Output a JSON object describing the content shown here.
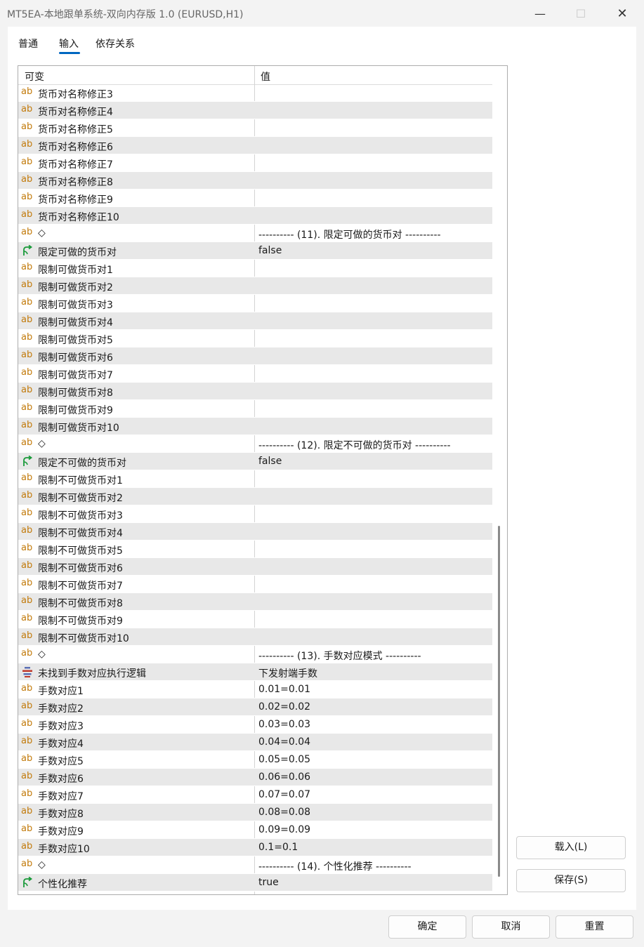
{
  "window": {
    "title": "MT5EA-本地跟单系统-双向内存版 1.0 (EURUSD,H1)"
  },
  "tabs": [
    "普通",
    "输入",
    "依存关系"
  ],
  "grid": {
    "headers": {
      "variable": "可变",
      "value": "值"
    },
    "rows": [
      {
        "icon": "ab",
        "name": "货币对名称修正3",
        "value": ""
      },
      {
        "icon": "ab",
        "name": "货币对名称修正4",
        "value": ""
      },
      {
        "icon": "ab",
        "name": "货币对名称修正5",
        "value": ""
      },
      {
        "icon": "ab",
        "name": "货币对名称修正6",
        "value": ""
      },
      {
        "icon": "ab",
        "name": "货币对名称修正7",
        "value": ""
      },
      {
        "icon": "ab",
        "name": "货币对名称修正8",
        "value": ""
      },
      {
        "icon": "ab",
        "name": "货币对名称修正9",
        "value": ""
      },
      {
        "icon": "ab",
        "name": "货币对名称修正10",
        "value": ""
      },
      {
        "icon": "ab",
        "name": "◇",
        "value": "---------- (11). 限定可做的货币对 ----------"
      },
      {
        "icon": "bool",
        "name": "限定可做的货币对",
        "value": "false"
      },
      {
        "icon": "ab",
        "name": "限制可做货币对1",
        "value": ""
      },
      {
        "icon": "ab",
        "name": "限制可做货币对2",
        "value": ""
      },
      {
        "icon": "ab",
        "name": "限制可做货币对3",
        "value": ""
      },
      {
        "icon": "ab",
        "name": "限制可做货币对4",
        "value": ""
      },
      {
        "icon": "ab",
        "name": "限制可做货币对5",
        "value": ""
      },
      {
        "icon": "ab",
        "name": "限制可做货币对6",
        "value": ""
      },
      {
        "icon": "ab",
        "name": "限制可做货币对7",
        "value": ""
      },
      {
        "icon": "ab",
        "name": "限制可做货币对8",
        "value": ""
      },
      {
        "icon": "ab",
        "name": "限制可做货币对9",
        "value": ""
      },
      {
        "icon": "ab",
        "name": "限制可做货币对10",
        "value": ""
      },
      {
        "icon": "ab",
        "name": "◇",
        "value": "---------- (12). 限定不可做的货币对 ----------"
      },
      {
        "icon": "bool",
        "name": "限定不可做的货币对",
        "value": "false"
      },
      {
        "icon": "ab",
        "name": "限制不可做货币对1",
        "value": ""
      },
      {
        "icon": "ab",
        "name": "限制不可做货币对2",
        "value": ""
      },
      {
        "icon": "ab",
        "name": "限制不可做货币对3",
        "value": ""
      },
      {
        "icon": "ab",
        "name": "限制不可做货币对4",
        "value": ""
      },
      {
        "icon": "ab",
        "name": "限制不可做货币对5",
        "value": ""
      },
      {
        "icon": "ab",
        "name": "限制不可做货币对6",
        "value": ""
      },
      {
        "icon": "ab",
        "name": "限制不可做货币对7",
        "value": ""
      },
      {
        "icon": "ab",
        "name": "限制不可做货币对8",
        "value": ""
      },
      {
        "icon": "ab",
        "name": "限制不可做货币对9",
        "value": ""
      },
      {
        "icon": "ab",
        "name": "限制不可做货币对10",
        "value": ""
      },
      {
        "icon": "ab",
        "name": "◇",
        "value": "---------- (13). 手数对应模式 ----------"
      },
      {
        "icon": "enum",
        "name": "未找到手数对应执行逻辑",
        "value": "下发射端手数"
      },
      {
        "icon": "ab",
        "name": "手数对应1",
        "value": "0.01=0.01"
      },
      {
        "icon": "ab",
        "name": "手数对应2",
        "value": "0.02=0.02"
      },
      {
        "icon": "ab",
        "name": "手数对应3",
        "value": "0.03=0.03"
      },
      {
        "icon": "ab",
        "name": "手数对应4",
        "value": "0.04=0.04"
      },
      {
        "icon": "ab",
        "name": "手数对应5",
        "value": "0.05=0.05"
      },
      {
        "icon": "ab",
        "name": "手数对应6",
        "value": "0.06=0.06"
      },
      {
        "icon": "ab",
        "name": "手数对应7",
        "value": "0.07=0.07"
      },
      {
        "icon": "ab",
        "name": "手数对应8",
        "value": "0.08=0.08"
      },
      {
        "icon": "ab",
        "name": "手数对应9",
        "value": "0.09=0.09"
      },
      {
        "icon": "ab",
        "name": "手数对应10",
        "value": "0.1=0.1"
      },
      {
        "icon": "ab",
        "name": "◇",
        "value": "---------- (14). 个性化推荐 ----------"
      },
      {
        "icon": "bool",
        "name": "个性化推荐",
        "value": "true"
      }
    ]
  },
  "side_buttons": {
    "load": "载入(L)",
    "save": "保存(S)"
  },
  "bottom_buttons": {
    "ok": "确定",
    "cancel": "取消",
    "reset": "重置"
  },
  "colors": {
    "accent": "#0067c0",
    "string_icon": "#c27a0a",
    "bool_icon": "#1a9a3a",
    "enum_icon": "#c0392b"
  }
}
